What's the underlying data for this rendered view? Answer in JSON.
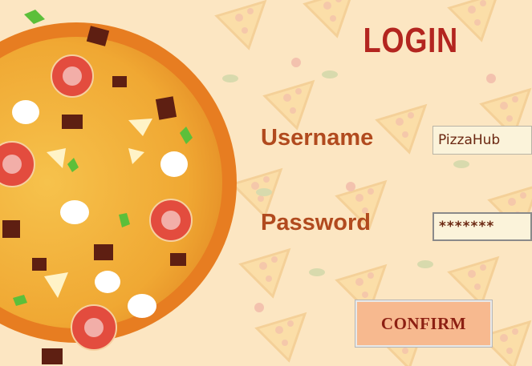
{
  "form": {
    "title": "LOGIN",
    "username_label": "Username",
    "password_label": "Password",
    "username_value": "PizzaHub",
    "password_value": "*******",
    "confirm_label": "CONFIRM"
  },
  "colors": {
    "background": "#fce6c2",
    "title": "#b3251f",
    "labels": "#b14a1e",
    "button_fill": "#f7b98f",
    "button_text": "#8c1f12"
  }
}
